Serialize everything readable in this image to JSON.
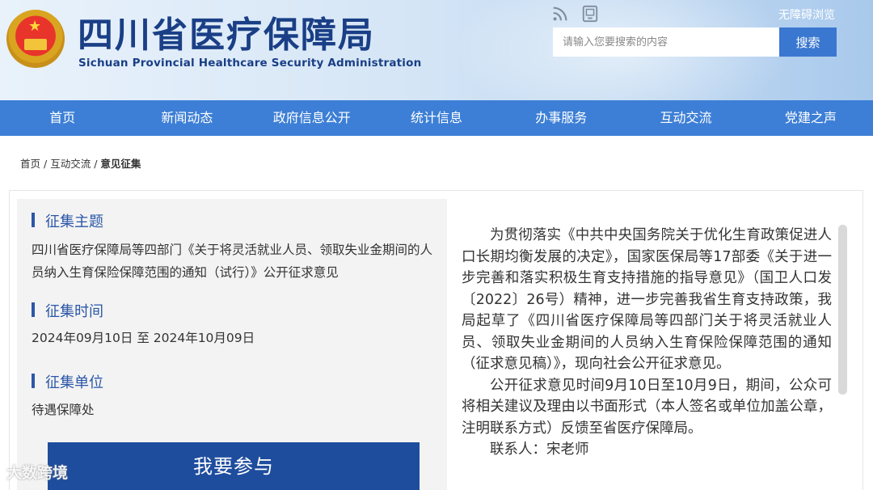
{
  "header": {
    "logo_cn": "四川省医疗保障局",
    "logo_en": "Sichuan Provincial Healthcare Security Administration",
    "accessibility_link": "无障碍浏览",
    "search_placeholder": "请输入您要搜索的内容",
    "search_button": "搜索",
    "icons": [
      "rss-icon",
      "mobile-site-icon"
    ]
  },
  "nav": {
    "items": [
      "首页",
      "新闻动态",
      "政府信息公开",
      "统计信息",
      "办事服务",
      "互动交流",
      "党建之声"
    ]
  },
  "breadcrumb": {
    "home": "首页",
    "sep": "/",
    "section": "互动交流",
    "current": "意见征集"
  },
  "sidebar": {
    "topic_title": "征集主题",
    "topic_body": "四川省医疗保障局等四部门《关于将灵活就业人员、领取失业金期间的人员纳入生育保险保障范围的通知（试行）》公开征求意见",
    "time_title": "征集时间",
    "time_body": "2024年09月10日 至 2024年10月09日",
    "unit_title": "征集单位",
    "unit_body": "待遇保障处",
    "join_button": "我要参与"
  },
  "article": {
    "paragraphs": [
      "为贯彻落实《中共中央国务院关于优化生育政策促进人口长期均衡发展的决定》，国家医保局等17部委《关于进一步完善和落实积极生育支持措施的指导意见》（国卫人口发〔2022〕26号）精神，进一步完善我省生育支持政策，我局起草了《四川省医疗保障局等四部门关于将灵活就业人员、领取失业金期间的人员纳入生育保险保障范围的通知（征求意见稿）》，现向社会公开征求意见。",
      "公开征求意见时间9月10日至10月9日，期间，公众可将相关建议及理由以书面形式（本人签名或单位加盖公章，注明联系方式）反馈至省医疗保障局。",
      "联系人：宋老师"
    ]
  },
  "watermark": "大数跨境",
  "colors": {
    "nav_bg": "#3d7fd6",
    "brand_blue": "#1a3f86",
    "join_button_bg": "#1e4d9e",
    "section_title": "#2b57a8"
  }
}
